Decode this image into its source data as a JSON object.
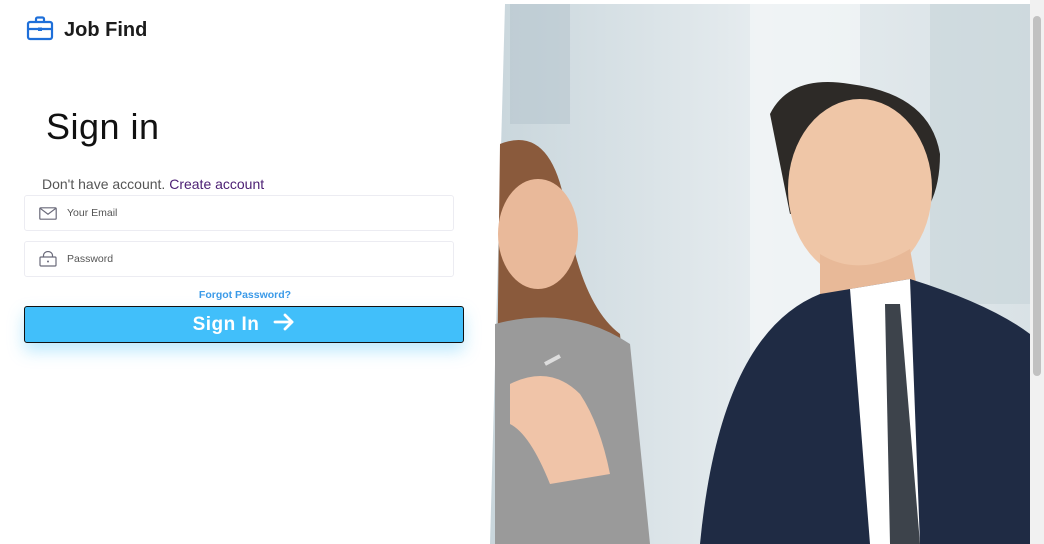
{
  "brand": {
    "name": "Job Find",
    "icon": "briefcase-icon"
  },
  "form": {
    "title": "Sign in",
    "no_account_text": "Don't have account.",
    "create_account_link": "Create account",
    "email_placeholder": "Your Email",
    "password_placeholder": "Password",
    "forgot_password": "Forgot Password?",
    "submit_label": "Sign In"
  },
  "colors": {
    "accent": "#41bffa",
    "link_purple": "#4b1e73",
    "forgot_blue": "#3b9ae8",
    "brand_icon": "#1e6fd9"
  }
}
